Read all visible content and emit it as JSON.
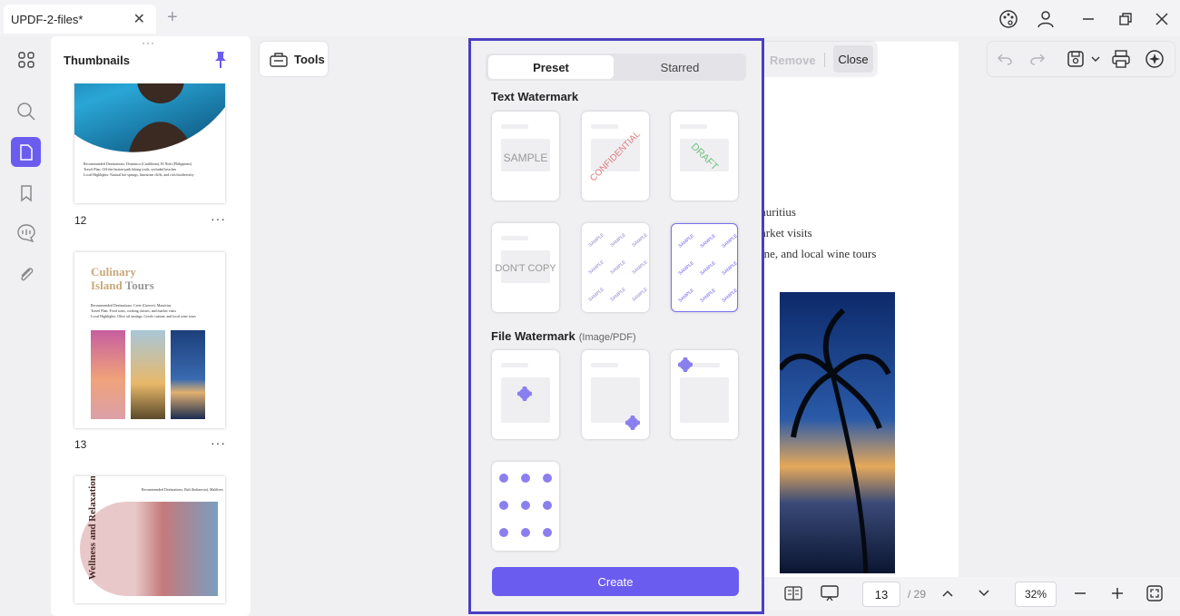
{
  "titlebar": {
    "tab_title": "UPDF-2-files*",
    "close_glyph": "✕",
    "new_tab_glyph": "+"
  },
  "thumbnails": {
    "title": "Thumbnails",
    "pages": [
      {
        "number": "12",
        "caption": "Recommended Destinations: Dominica (Caribbean), El Nido (Philippines)\nTravel Plan: Off-the-beaten-path hiking trails, secluded beaches\nLocal Highlights: Natural hot springs, limestone cliffs, and rich biodiversity"
      },
      {
        "number": "13",
        "title_line1_a": "Culinary",
        "title_line2_a": "Island",
        "title_line2_b": "Tours",
        "caption": "Recommended Destinations: Crete (Greece), Mauritius\nTravel Plan: Food tours, cooking classes, and market visits\nLocal Highlights: Olive oil tastings, Creole cuisine, and local wine tours"
      },
      {
        "number": "",
        "title": "Wellness and Relaxation",
        "caption": "Recommended Destinations: Bali (Indonesia), Maldives"
      }
    ],
    "more_glyph": "···"
  },
  "toolbar": {
    "tools_label": "Tools",
    "remove_label": "Remove",
    "close_label": "Close"
  },
  "document": {
    "lines": [
      "auritius",
      "arket visits",
      "ine, and local wine tours"
    ]
  },
  "watermark": {
    "tab_preset": "Preset",
    "tab_starred": "Starred",
    "text_section": "Text Watermark",
    "file_section": "File Watermark",
    "file_section_sub": "(Image/PDF)",
    "text_samples": [
      "SAMPLE",
      "CONFIDENTIAL",
      "DRAFT",
      "DON'T COPY"
    ],
    "create_label": "Create",
    "accent": "#6b5cf0",
    "selected_index": 5
  },
  "bottombar": {
    "page_value": "13",
    "page_total": "/ 29",
    "zoom": "32%"
  },
  "colors": {
    "accent": "#6b5cf0",
    "panel_border": "#4b3fc0"
  }
}
